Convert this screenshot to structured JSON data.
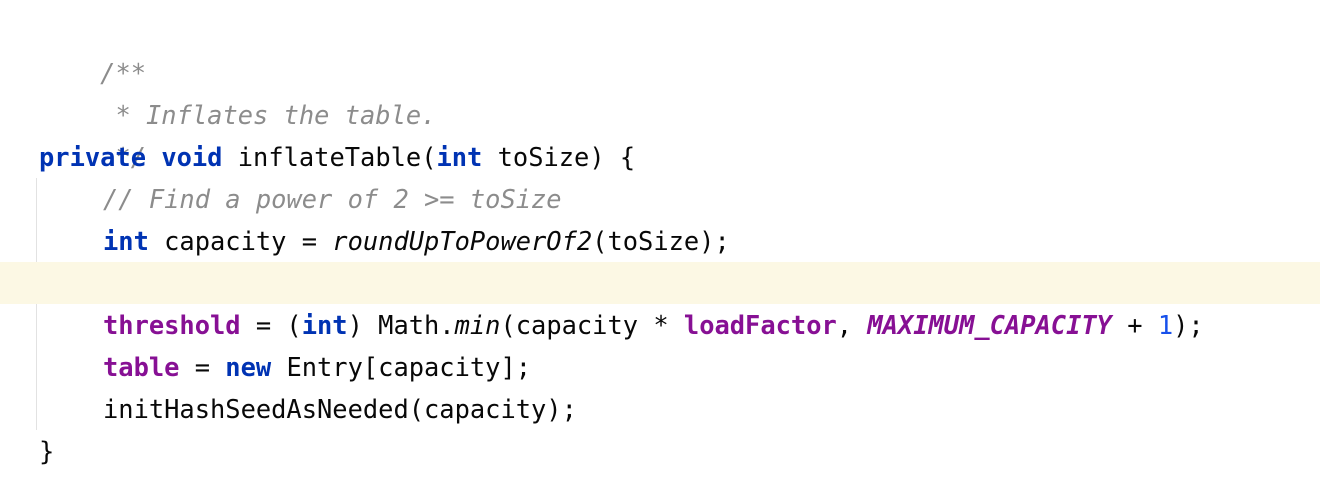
{
  "editor": {
    "language": "Java",
    "colors": {
      "background": "#ffffff",
      "current_line": "#fcf8e4",
      "keyword": "#0033b3",
      "field": "#871094",
      "comment": "#8c8c8c",
      "number": "#1750eb",
      "text": "#080808"
    },
    "lines": [
      {
        "doc": "/**"
      },
      {
        "doc": " * Inflates the table."
      },
      {
        "doc": " */"
      },
      {
        "kw_private": "private",
        "kw_void": "void",
        "method_name": " inflateTable(",
        "kw_int": "int",
        "param": " toSize) {"
      },
      {
        "comment": "// Find a power of 2 >= toSize"
      },
      {
        "kw_int": "int",
        "decl": " capacity = ",
        "call": "roundUpToPowerOf2",
        "args": "(toSize);"
      },
      {
        "empty": ""
      },
      {
        "field": "threshold",
        "eq": " = (",
        "kw_int": "int",
        "cast_close": ") Math.",
        "call": "min",
        "args_open": "(capacity * ",
        "field2": "loadFactor",
        "comma": ", ",
        "const": "MAXIMUM_CAPACITY",
        "plus": " + ",
        "num": "1",
        "close": ");"
      },
      {
        "field": "table",
        "eq": " = ",
        "kw_new": "new",
        "rest": " Entry[capacity];"
      },
      {
        "stmt": "initHashSeedAsNeeded(capacity);"
      },
      {
        "brace": "}"
      }
    ]
  }
}
